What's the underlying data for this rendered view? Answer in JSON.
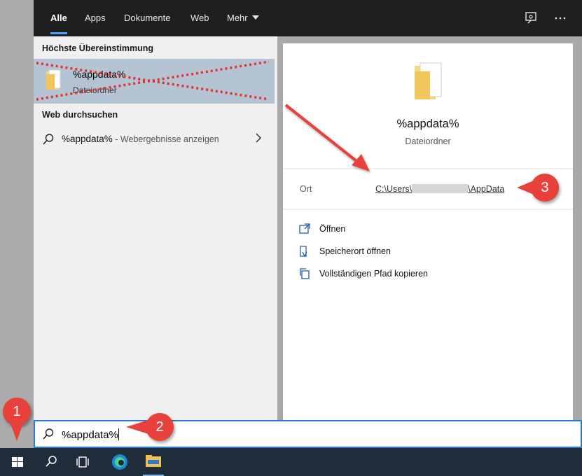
{
  "tabs": [
    {
      "label": "Alle"
    },
    {
      "label": "Apps"
    },
    {
      "label": "Dokumente"
    },
    {
      "label": "Web"
    },
    {
      "label": "Mehr"
    }
  ],
  "top_icons": [
    "feedback-icon",
    "more-options-icon"
  ],
  "left": {
    "best_match_title": "Höchste Übereinstimmung",
    "best_match": {
      "name": "%appdata%",
      "type": "Dateiordner"
    },
    "web_title": "Web durchsuchen",
    "web_result": {
      "query": "%appdata%",
      "hint": " - Webergebnisse anzeigen"
    }
  },
  "preview": {
    "name": "%appdata%",
    "type": "Dateiordner",
    "location_label": "Ort",
    "path_prefix": "C:\\Users\\",
    "path_suffix": "\\AppData",
    "actions": [
      {
        "label": "Öffnen",
        "icon": "open-icon"
      },
      {
        "label": "Speicherort öffnen",
        "icon": "file-location-icon"
      },
      {
        "label": "Vollständigen Pfad kopieren",
        "icon": "copy-path-icon"
      }
    ]
  },
  "search": {
    "value": "%appdata%"
  },
  "taskbar": [
    "start-icon",
    "search-icon",
    "task-view-icon",
    "edge-icon",
    "file-explorer-icon"
  ],
  "annotations": [
    "1",
    "2",
    "3"
  ],
  "colors": {
    "accent": "#2b7ad8",
    "annotation": "#e8403a",
    "highlight": "#b5c4d3"
  }
}
